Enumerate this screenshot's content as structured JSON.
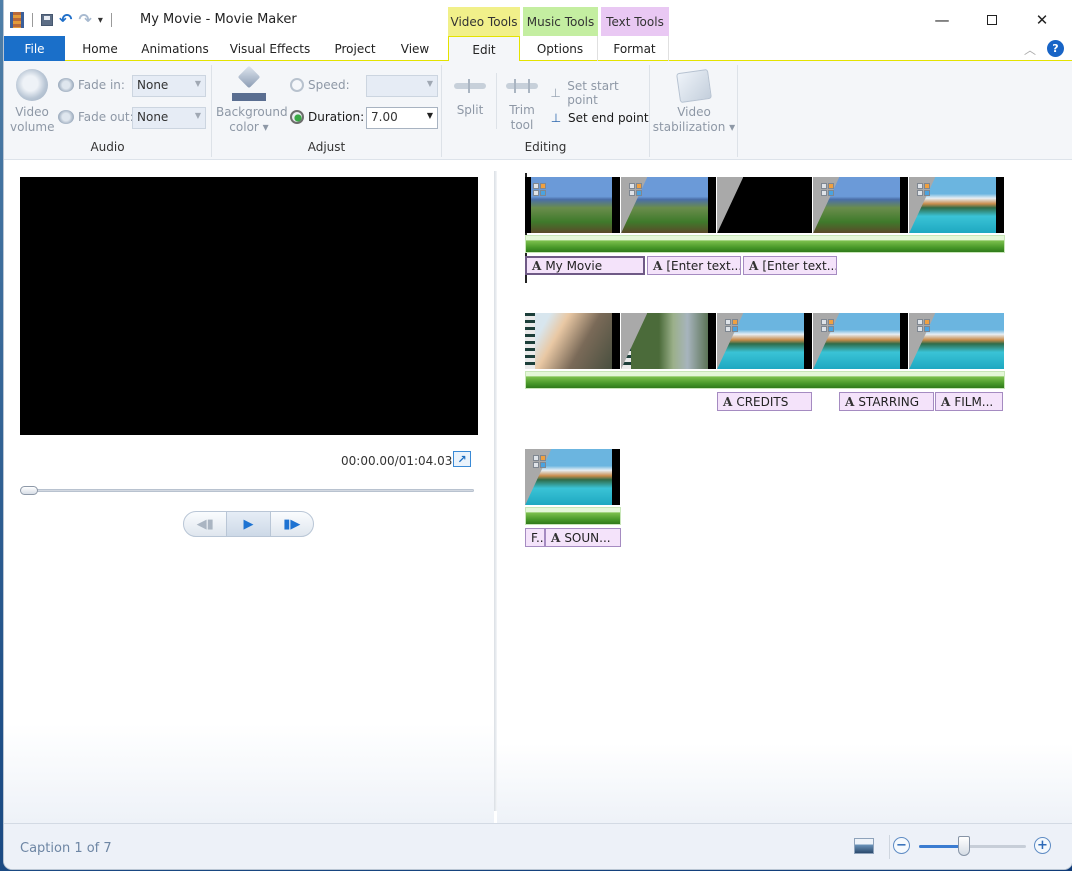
{
  "window": {
    "title": "My Movie - Movie Maker",
    "controls": {
      "minimize": "—",
      "close": "✕"
    }
  },
  "qat": {
    "undo": "↶",
    "redo": "↷",
    "dropdown": "▾"
  },
  "context_groups": {
    "video_tools": {
      "label": "Video Tools",
      "color": "#f1f08a"
    },
    "music_tools": {
      "label": "Music Tools",
      "color": "#c4eea1"
    },
    "text_tools": {
      "label": "Text Tools",
      "color": "#e9c8f3"
    }
  },
  "tabs": [
    {
      "label": "File",
      "active": false
    },
    {
      "label": "Home",
      "active": false
    },
    {
      "label": "Animations",
      "active": false
    },
    {
      "label": "Visual Effects",
      "active": false
    },
    {
      "label": "Project",
      "active": false
    },
    {
      "label": "View",
      "active": false
    },
    {
      "label": "Edit",
      "active": true
    },
    {
      "label": "Options",
      "active": false
    },
    {
      "label": "Format",
      "active": false
    }
  ],
  "ribbon_misc": {
    "collapse": "︿",
    "help": "?"
  },
  "ribbon": {
    "audio": {
      "label": "Audio",
      "video_volume": "Video volume",
      "video_volume_l1": "Video",
      "video_volume_l2": "volume",
      "fade_in_label": "Fade in:",
      "fade_in_value": "None",
      "fade_out_label": "Fade out:",
      "fade_out_value": "None"
    },
    "adjust": {
      "label": "Adjust",
      "background_color_l1": "Background",
      "background_color_l2": "color ▾",
      "speed_label": "Speed:",
      "speed_value": "",
      "duration_label": "Duration:",
      "duration_value": "7.00"
    },
    "editing": {
      "label": "Editing",
      "split": "Split",
      "trim_l1": "Trim",
      "trim_l2": "tool",
      "set_start": "Set start point",
      "set_end": "Set end point"
    },
    "stabilization": {
      "l1": "Video",
      "l2": "stabilization ▾"
    }
  },
  "preview": {
    "time": "00:00.00/01:04.03",
    "fullscreen_glyph": "↗",
    "seek_progress": 0,
    "transport": {
      "prev": "◀▮",
      "play": "▶",
      "next": "▮▶"
    }
  },
  "storyboard": {
    "rows": [
      {
        "clips": [
          "mountain",
          "mountain",
          "black",
          "mountain",
          "lake"
        ],
        "captions": [
          {
            "text": "My Movie",
            "selected": true
          },
          {
            "text": "[Enter text...",
            "selected": false
          },
          {
            "text": "[Enter text...",
            "selected": false
          }
        ]
      },
      {
        "clips": [
          "couple",
          "man",
          "lake",
          "lake",
          "lake"
        ],
        "captions": [
          {
            "text": "CREDITS"
          },
          {
            "text": "STARRING"
          },
          {
            "text": "FILM..."
          }
        ]
      },
      {
        "clips": [
          "lake"
        ],
        "captions": [
          {
            "text": "F..",
            "short": true
          },
          {
            "text": "SOUN..."
          }
        ]
      }
    ],
    "caption_glyph": "A"
  },
  "statusbar": {
    "status": "Caption 1 of 7",
    "zoom_out": "−",
    "zoom_in": "+",
    "zoom_level": 0.42
  }
}
